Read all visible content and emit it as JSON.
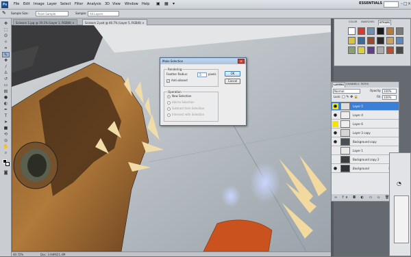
{
  "menubar": {
    "logo": "Ps",
    "items": [
      "File",
      "Edit",
      "Image",
      "Layer",
      "Select",
      "Filter",
      "Analysis",
      "3D",
      "View",
      "Window",
      "Help"
    ],
    "workspace": "ESSENTIALS"
  },
  "options_bar": {
    "sample_size_label": "Sample Size:",
    "sample_size_value": "Point Sample",
    "sample_label": "Sample:",
    "sample_value": "All Layers"
  },
  "document_tabs": [
    {
      "label": "Scissors 1.jpg @ 19.1% (Layer 1, RGB/8) ×",
      "active": false
    },
    {
      "label": "Scissors 2.psd @ 40.7% (Layer 5, RGB/8) ×",
      "active": true
    }
  ],
  "status_bar": {
    "zoom": "40.72%",
    "doc_info": "Doc: 3.94M/21.4M"
  },
  "styles_panel": {
    "tabs": [
      "COLOR",
      "SWATCHES",
      "STYLES"
    ],
    "active_tab": "STYLES",
    "swatch_colors": [
      "#ffffff",
      "#d93a2e",
      "#6f8fb8",
      "#1c1c1c",
      "#b87a3a",
      "#7a7a7a",
      "#d6c23c",
      "#3c6a9c",
      "#9b4a2c",
      "#2c2c2c",
      "#c8a060",
      "#5c88c0",
      "#8ba070",
      "#d8d040",
      "#603e8c",
      "#aaaaaa",
      "#b45030",
      "#4a4a4a"
    ]
  },
  "layers_panel": {
    "tabs": [
      "LAYERS",
      "CHANNELS",
      "PATHS"
    ],
    "active_tab": "LAYERS",
    "blend_mode": "Normal",
    "opacity_label": "Opacity:",
    "opacity": "100%",
    "lock_label": "Lock:",
    "fill_label": "Fill:",
    "fill": "100%",
    "layers": [
      {
        "name": "Layer 5",
        "selected": true,
        "eye": "on-yellow"
      },
      {
        "name": "Layer 4",
        "selected": false,
        "eye": "on"
      },
      {
        "name": "Layer 6",
        "selected": false,
        "eye": "yellow"
      },
      {
        "name": "Layer 3 copy",
        "selected": false,
        "eye": "on"
      },
      {
        "name": "Background copy",
        "selected": false,
        "eye": "on"
      },
      {
        "name": "Layer 1",
        "selected": false,
        "eye": "none"
      },
      {
        "name": "Background copy 2",
        "selected": false,
        "eye": "none"
      },
      {
        "name": "Background",
        "selected": false,
        "eye": "on",
        "italic": true,
        "locked": true
      }
    ]
  },
  "dialog": {
    "title": "Make Selection",
    "rendering_label": "Rendering",
    "feather_label": "Feather Radius:",
    "feather_value": ".5",
    "feather_unit": "pixels",
    "antialiased_label": "Anti-aliased",
    "antialiased_checked": true,
    "operation_label": "Operation",
    "options": [
      {
        "label": "New Selection",
        "selected": true,
        "enabled": true
      },
      {
        "label": "Add to Selection",
        "selected": false,
        "enabled": false
      },
      {
        "label": "Subtract from Selection",
        "selected": false,
        "enabled": false
      },
      {
        "label": "Intersect with Selection",
        "selected": false,
        "enabled": false
      }
    ],
    "ok_label": "OK",
    "cancel_label": "Cancel"
  }
}
